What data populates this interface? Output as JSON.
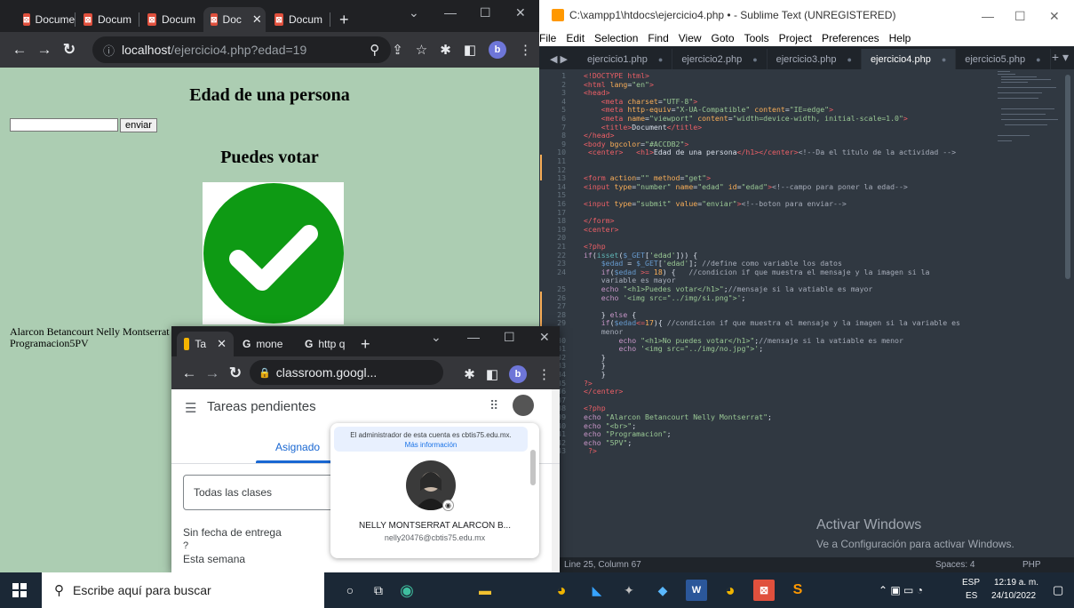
{
  "browser": {
    "tabs": [
      {
        "label": "Docume",
        "active": false
      },
      {
        "label": "Docum",
        "active": false
      },
      {
        "label": "Docum",
        "active": false
      },
      {
        "label": "Doc",
        "active": true
      },
      {
        "label": "Docum",
        "active": false
      }
    ],
    "address_host": "localhost",
    "address_path": "/ejercicio4.php?edad=19",
    "profile_initial": "b"
  },
  "page": {
    "title": "Edad de una persona",
    "submit_label": "enviar",
    "result_heading": "Puedes votar",
    "footer_line1": "Alarcon Betancourt Nelly Montserrat",
    "footer_line2": "Programacion5PV",
    "bgcolor": "#ACCDB2"
  },
  "editor": {
    "window_title": "C:\\xampp1\\htdocs\\ejercicio4.php • - Sublime Text (UNREGISTERED)",
    "menu": [
      "File",
      "Edit",
      "Selection",
      "Find",
      "View",
      "Goto",
      "Tools",
      "Project",
      "Preferences",
      "Help"
    ],
    "tabs": [
      "ejercicio1.php",
      "ejercicio2.php",
      "ejercicio3.php",
      "ejercicio4.php",
      "ejercicio5.php"
    ],
    "active_tab": "ejercicio4.php",
    "status_position": "Line 25, Column 67",
    "status_spaces": "Spaces: 4",
    "status_syntax": "PHP",
    "watermark_title": "Activar Windows",
    "watermark_sub": "Ve a Configuración para activar Windows."
  },
  "popup": {
    "tabs": [
      "Ta",
      "mone",
      "http q"
    ],
    "address": "classroom.googl...",
    "app_title": "Tareas pendientes",
    "tab_assigned": "Asignado",
    "class_filter": "Todas las clases",
    "section_no_date": "Sin fecha de entrega",
    "section_this_week": "Esta semana",
    "account_notice": "El administrador de esta cuenta es cbtis75.edu.mx.",
    "account_more_info": "Más información",
    "account_name": "NELLY MONTSERRAT ALARCON B...",
    "account_email": "nelly20476@cbtis75.edu.mx"
  },
  "taskbar": {
    "search_placeholder": "Escribe aquí para buscar",
    "lang_top": "ESP",
    "lang_bottom": "ES",
    "time": "12:19 a. m.",
    "date": "24/10/2022"
  }
}
